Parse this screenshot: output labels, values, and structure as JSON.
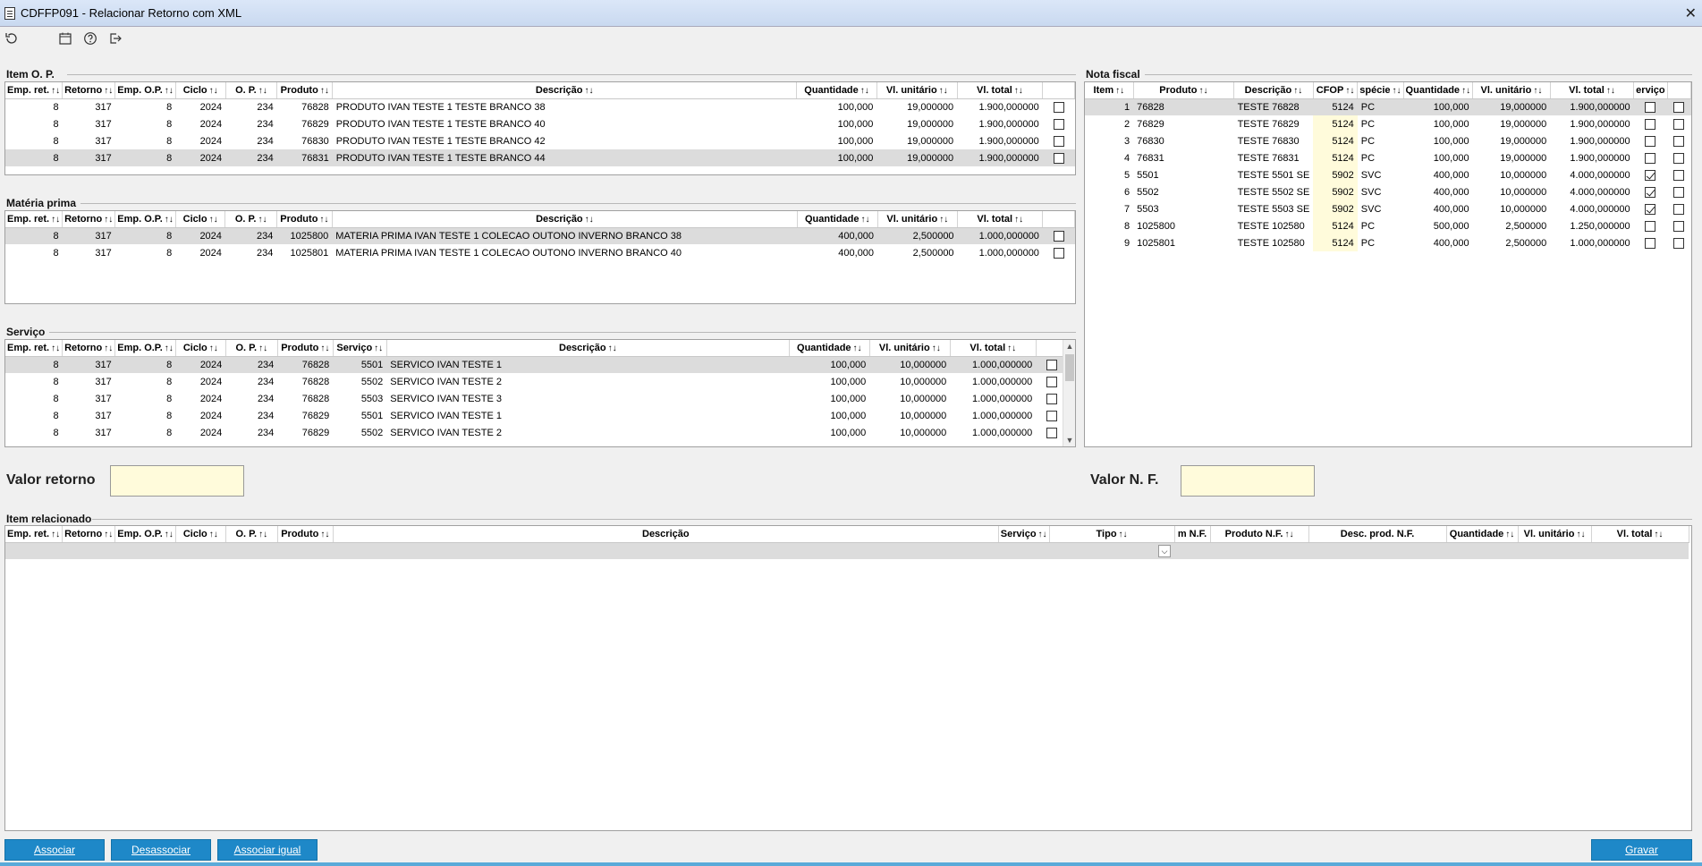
{
  "window": {
    "title": "CDFFP091 - Relacionar Retorno com XML"
  },
  "toolbar": {
    "icons": [
      "refresh-icon",
      "calendar-icon",
      "help-icon",
      "exit-icon"
    ]
  },
  "item_op": {
    "title": "Item O. P.",
    "columns": [
      "Emp. ret.",
      "Retorno",
      "Emp. O.P.",
      "Ciclo",
      "O. P.",
      "Produto",
      "Descrição",
      "Quantidade",
      "Vl. unitário",
      "Vl. total"
    ],
    "rows": [
      [
        "8",
        "317",
        "8",
        "2024",
        "234",
        "76828",
        "PRODUTO IVAN TESTE 1 TESTE BRANCO 38",
        "100,000",
        "19,000000",
        "1.900,000000"
      ],
      [
        "8",
        "317",
        "8",
        "2024",
        "234",
        "76829",
        "PRODUTO IVAN TESTE 1 TESTE BRANCO 40",
        "100,000",
        "19,000000",
        "1.900,000000"
      ],
      [
        "8",
        "317",
        "8",
        "2024",
        "234",
        "76830",
        "PRODUTO IVAN TESTE 1 TESTE BRANCO 42",
        "100,000",
        "19,000000",
        "1.900,000000"
      ],
      [
        "8",
        "317",
        "8",
        "2024",
        "234",
        "76831",
        "PRODUTO IVAN TESTE 1 TESTE BRANCO 44",
        "100,000",
        "19,000000",
        "1.900,000000"
      ]
    ],
    "checked": [
      false,
      false,
      false,
      false
    ],
    "selected_row": 3
  },
  "materia_prima": {
    "title": "Matéria prima",
    "columns": [
      "Emp. ret.",
      "Retorno",
      "Emp. O.P.",
      "Ciclo",
      "O. P.",
      "Produto",
      "Descrição",
      "Quantidade",
      "Vl. unitário",
      "Vl. total"
    ],
    "rows": [
      [
        "8",
        "317",
        "8",
        "2024",
        "234",
        "1025800",
        "MATERIA PRIMA IVAN TESTE 1 COLECAO OUTONO INVERNO BRANCO 38",
        "400,000",
        "2,500000",
        "1.000,000000"
      ],
      [
        "8",
        "317",
        "8",
        "2024",
        "234",
        "1025801",
        "MATERIA PRIMA IVAN TESTE 1 COLECAO OUTONO INVERNO BRANCO 40",
        "400,000",
        "2,500000",
        "1.000,000000"
      ]
    ],
    "checked": [
      false,
      false
    ],
    "selected_row": 0
  },
  "servico": {
    "title": "Serviço",
    "columns": [
      "Emp. ret.",
      "Retorno",
      "Emp. O.P.",
      "Ciclo",
      "O. P.",
      "Produto",
      "Serviço",
      "Descrição",
      "Quantidade",
      "Vl. unitário",
      "Vl. total"
    ],
    "rows": [
      [
        "8",
        "317",
        "8",
        "2024",
        "234",
        "76828",
        "5501",
        "SERVICO IVAN TESTE 1",
        "100,000",
        "10,000000",
        "1.000,000000"
      ],
      [
        "8",
        "317",
        "8",
        "2024",
        "234",
        "76828",
        "5502",
        "SERVICO IVAN TESTE 2",
        "100,000",
        "10,000000",
        "1.000,000000"
      ],
      [
        "8",
        "317",
        "8",
        "2024",
        "234",
        "76828",
        "5503",
        "SERVICO IVAN TESTE 3",
        "100,000",
        "10,000000",
        "1.000,000000"
      ],
      [
        "8",
        "317",
        "8",
        "2024",
        "234",
        "76829",
        "5501",
        "SERVICO IVAN TESTE 1",
        "100,000",
        "10,000000",
        "1.000,000000"
      ],
      [
        "8",
        "317",
        "8",
        "2024",
        "234",
        "76829",
        "5502",
        "SERVICO IVAN TESTE 2",
        "100,000",
        "10,000000",
        "1.000,000000"
      ]
    ],
    "checked": [
      false,
      false,
      false,
      false,
      false
    ],
    "selected_row": 0
  },
  "nota_fiscal": {
    "title": "Nota fiscal",
    "columns": [
      "Item",
      "Produto",
      "Descrição",
      "CFOP",
      "spécie",
      "Quantidade",
      "Vl. unitário",
      "Vl. total",
      "erviço"
    ],
    "rows": [
      [
        "1",
        "76828",
        "TESTE 76828",
        "5124",
        "PC",
        "100,000",
        "19,000000",
        "1.900,000000"
      ],
      [
        "2",
        "76829",
        "TESTE 76829",
        "5124",
        "PC",
        "100,000",
        "19,000000",
        "1.900,000000"
      ],
      [
        "3",
        "76830",
        "TESTE 76830",
        "5124",
        "PC",
        "100,000",
        "19,000000",
        "1.900,000000"
      ],
      [
        "4",
        "76831",
        "TESTE 76831",
        "5124",
        "PC",
        "100,000",
        "19,000000",
        "1.900,000000"
      ],
      [
        "5",
        "5501",
        "TESTE 5501 SE",
        "5902",
        "SVC",
        "400,000",
        "10,000000",
        "4.000,000000"
      ],
      [
        "6",
        "5502",
        "TESTE 5502 SE",
        "5902",
        "SVC",
        "400,000",
        "10,000000",
        "4.000,000000"
      ],
      [
        "7",
        "5503",
        "TESTE 5503 SE",
        "5902",
        "SVC",
        "400,000",
        "10,000000",
        "4.000,000000"
      ],
      [
        "8",
        "1025800",
        "TESTE 102580",
        "5124",
        "PC",
        "500,000",
        "2,500000",
        "1.250,000000"
      ],
      [
        "9",
        "1025801",
        "TESTE 102580",
        "5124",
        "PC",
        "400,000",
        "2,500000",
        "1.000,000000"
      ]
    ],
    "servico_checked": [
      false,
      false,
      false,
      false,
      true,
      true,
      true,
      false,
      false
    ],
    "row_checked": [
      false,
      false,
      false,
      false,
      false,
      false,
      false,
      false,
      false
    ],
    "selected_row": 0
  },
  "valor_retorno": {
    "label": "Valor retorno",
    "value": ""
  },
  "valor_nf": {
    "label": "Valor N. F.",
    "value": ""
  },
  "item_relacionado": {
    "title": "Item relacionado",
    "columns": [
      "Emp. ret.",
      "Retorno",
      "Emp. O.P.",
      "Ciclo",
      "O. P.",
      "Produto",
      "Descrição",
      "Serviço",
      "Tipo",
      "m N.F.",
      "Produto N.F.",
      "Desc. prod. N.F.",
      "Quantidade",
      "Vl. unitário",
      "Vl. total"
    ]
  },
  "buttons": {
    "associar": "Associar",
    "desassociar": "Desassociar",
    "associar_igual": "Associar igual",
    "gravar": "Gravar"
  }
}
